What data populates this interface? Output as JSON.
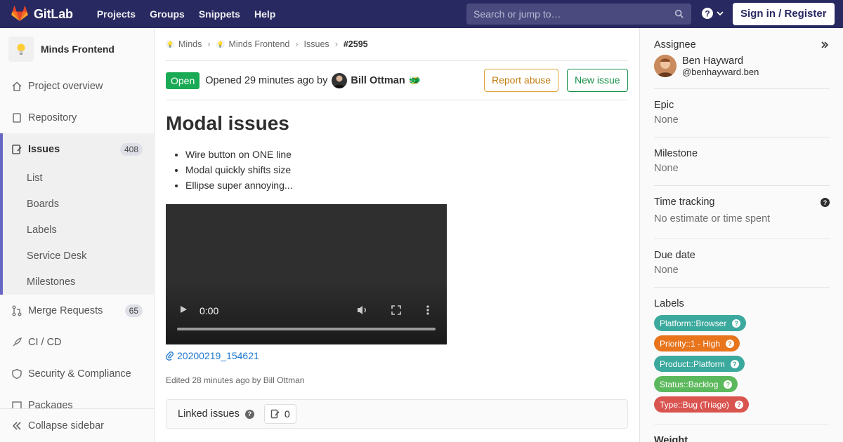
{
  "navbar": {
    "brand": "GitLab",
    "items": [
      "Projects",
      "Groups",
      "Snippets",
      "Help"
    ],
    "search_placeholder": "Search or jump to…",
    "signin": "Sign in / Register",
    "colors": {
      "bg": "#292961",
      "search_bg": "#4a4a7e"
    }
  },
  "sidebar": {
    "project_name": "Minds Frontend",
    "items": [
      {
        "label": "Project overview",
        "icon": "home-icon"
      },
      {
        "label": "Repository",
        "icon": "book-icon"
      },
      {
        "label": "Issues",
        "icon": "issues-icon",
        "count": "408"
      },
      {
        "label": "Merge Requests",
        "icon": "merge-request-icon",
        "count": "65"
      },
      {
        "label": "CI / CD",
        "icon": "rocket-icon"
      },
      {
        "label": "Security & Compliance",
        "icon": "shield-icon"
      },
      {
        "label": "Packages",
        "icon": "package-icon"
      }
    ],
    "issues_sub": [
      "List",
      "Boards",
      "Labels",
      "Service Desk",
      "Milestones"
    ],
    "collapse": "Collapse sidebar",
    "active_color": "#6666c4"
  },
  "breadcrumb": [
    "Minds",
    "Minds Frontend",
    "Issues",
    "#2595"
  ],
  "issue": {
    "status": "Open",
    "opened_prefix": "Opened 29 minutes ago by",
    "author": "Bill Ottman",
    "author_emoji": "🐲",
    "report_abuse": "Report abuse",
    "new_issue": "New issue",
    "title": "Modal issues",
    "description": [
      "Wire button on ONE line",
      "Modal quickly shifts size",
      "Ellipse super annoying..."
    ],
    "video_time": "0:00",
    "attachment": "20200219_154621",
    "edited": "Edited 28 minutes ago by Bill Ottman",
    "linked_issues_label": "Linked issues",
    "linked_issues_count": "0"
  },
  "right_sidebar": {
    "assignee": {
      "title": "Assignee",
      "name": "Ben Hayward",
      "handle": "@benhayward.ben"
    },
    "epic": {
      "title": "Epic",
      "value": "None"
    },
    "milestone": {
      "title": "Milestone",
      "value": "None"
    },
    "time_tracking": {
      "title": "Time tracking",
      "value": "No estimate or time spent"
    },
    "due_date": {
      "title": "Due date",
      "value": "None"
    },
    "labels_title": "Labels",
    "labels": [
      {
        "text": "Platform::Browser",
        "color": "#3ba99d"
      },
      {
        "text": "Priority::1 - High",
        "color": "#e8741c"
      },
      {
        "text": "Product::Platform",
        "color": "#3ba99d"
      },
      {
        "text": "Status::Backlog",
        "color": "#5cb85c"
      },
      {
        "text": "Type::Bug (Triage)",
        "color": "#d9534f"
      }
    ],
    "weight_title": "Weight"
  }
}
